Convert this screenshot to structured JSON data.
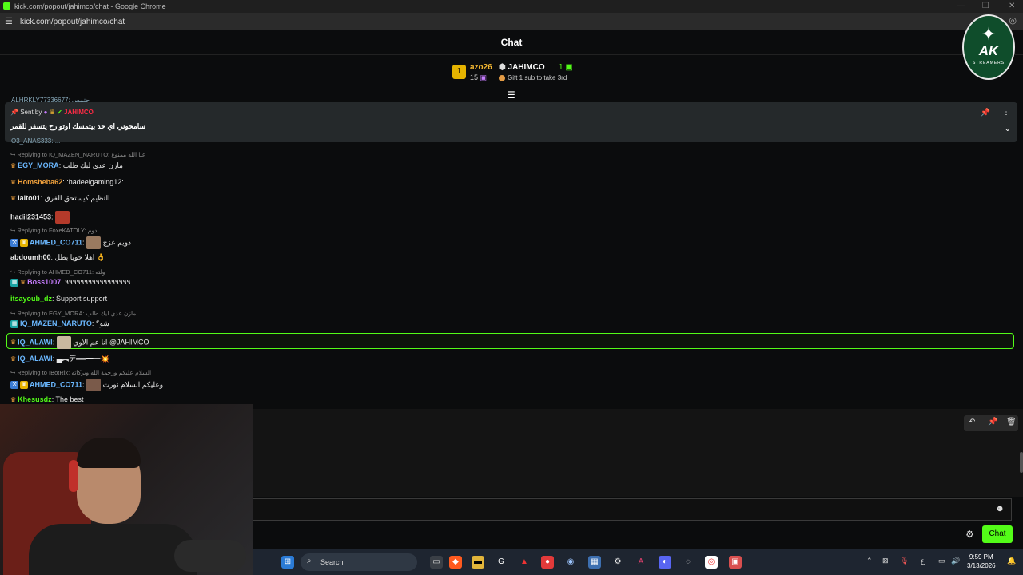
{
  "browser": {
    "window_title": "kick.com/popout/jahimco/chat - Google Chrome",
    "url": "kick.com/popout/jahimco/chat"
  },
  "chat": {
    "header_title": "Chat",
    "logo": {
      "text": "AK",
      "sub": "STREAMERS"
    },
    "leaderboard": {
      "rank": "1",
      "top_user": "azo26",
      "top_count": "15",
      "streamer": "JAHIMCO",
      "streamer_count": "1",
      "goal": "Gift 1 sub to take 3rd"
    },
    "pinned": {
      "label": "Sent by",
      "sender": "JAHIMCO",
      "message": "سامحوني اي حد بيتمسك اوتو رح يتسفر للقمر",
      "peek_top": "ALHRKLY77336677: حتمس",
      "peek_bottom": "O3_ANAS333: ..."
    },
    "messages": [
      {
        "type": "reply",
        "text": "Replying to IQ_MAZEN_NARUTO: عيا الله ممنوع"
      },
      {
        "type": "msg",
        "user": "EGY_MORA",
        "color": "#6bb8ff",
        "text": "مازن عدي ليك طلب"
      },
      {
        "type": "msg",
        "user": "Homsheba62",
        "color": "#f2a23c",
        "text": ":hadeelgaming12:"
      },
      {
        "type": "msg",
        "user": "laito01",
        "color": "#e8e8e8",
        "text": "التظيم كيستحق الفرق"
      },
      {
        "type": "msg",
        "user": "hadil231453",
        "color": "#e8e8e8",
        "text": ""
      },
      {
        "type": "reply",
        "text": "Replying to FoxeKATOLY: دوم"
      },
      {
        "type": "msg",
        "user": "AHMED_CO711",
        "color": "#6bb8ff",
        "text": "دويم عزج"
      },
      {
        "type": "msg",
        "user": "abdoumh00",
        "color": "#e8e8e8",
        "text": "اهلا خويا بطل 👌"
      },
      {
        "type": "reply",
        "text": "Replying to AHMED_CO711: ولته"
      },
      {
        "type": "msg",
        "user": "Boss1007",
        "color": "#c77dff",
        "text": "٩٩٩٩٩٩٩٩٩٩٩٩٩٩٩٩٩"
      },
      {
        "type": "msg",
        "user": "itsayoub_dz",
        "color": "#53fc18",
        "text": "Support support"
      },
      {
        "type": "reply",
        "text": "Replying to EGY_MORA: مازن عدي ليك طلب"
      },
      {
        "type": "msg",
        "user": "IQ_MAZEN_NARUTO",
        "color": "#6bb8ff",
        "text": "شو؟"
      },
      {
        "type": "msg",
        "user": "IQ_ALAWI",
        "color": "#6bb8ff",
        "text": "انا عم الاوي @JAHIMCO"
      },
      {
        "type": "msg",
        "user": "IQ_ALAWI",
        "color": "#6bb8ff",
        "text": "▄︻デ══━一💥"
      },
      {
        "type": "reply",
        "text": "Replying to IBotRix: السلام عليكم ورحمة الله وبركاته"
      },
      {
        "type": "msg",
        "user": "AHMED_CO711",
        "color": "#6bb8ff",
        "text": "وعليكم السلام نورت"
      },
      {
        "type": "msg",
        "user": "Khesusdz",
        "color": "#53fc18",
        "text": "The best"
      }
    ],
    "send_button": "Chat"
  },
  "taskbar": {
    "search_label": "Search",
    "time": "9:59 PM",
    "date": "3/13/2026",
    "lang": "ع"
  },
  "colors": {
    "kick_green": "#53fc18",
    "bg": "#0b0c0d",
    "pinned_bg": "#25292b"
  }
}
